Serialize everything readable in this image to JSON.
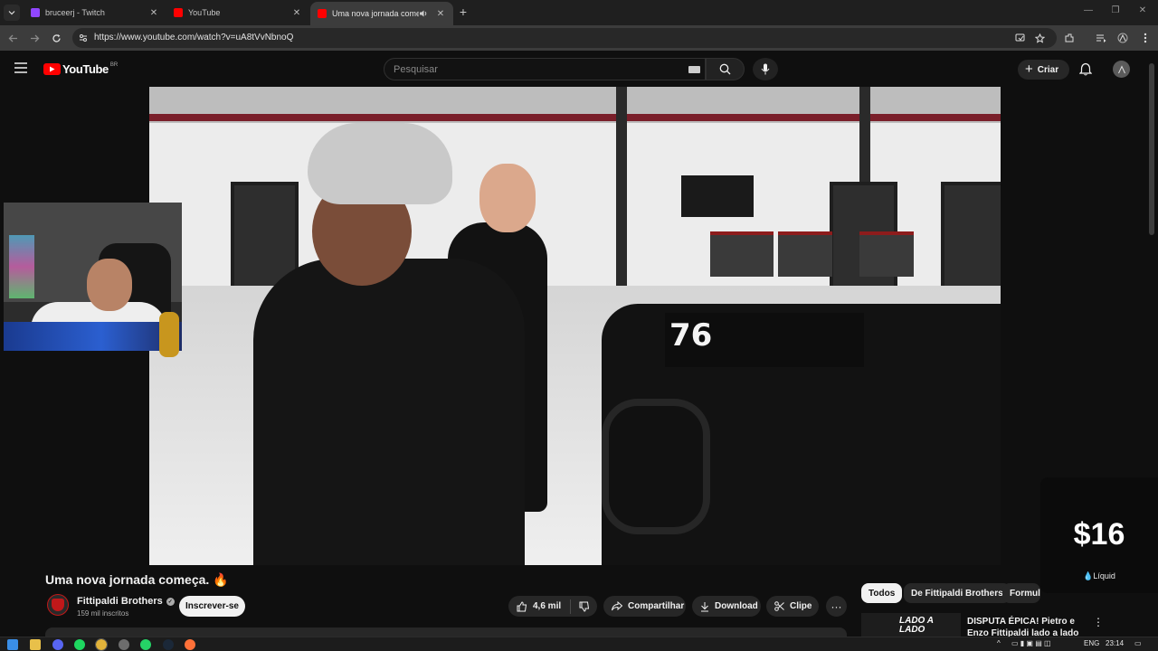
{
  "browser": {
    "tabs": [
      {
        "title": "bruceerj - Twitch",
        "favicon_color": "#9146ff",
        "active": false
      },
      {
        "title": "YouTube",
        "favicon_color": "#ff0000",
        "active": false
      },
      {
        "title": "Uma nova jornada começa",
        "favicon_color": "#ff0000",
        "active": true,
        "audio": true
      }
    ],
    "url": "https://www.youtube.com/watch?v=uA8tVvNbnoQ",
    "new_tab_label": "+",
    "window_controls": {
      "minimize": "—",
      "restore": "❐",
      "close": "✕"
    }
  },
  "youtube": {
    "logo_text": "YouTube",
    "country_code": "BR",
    "search_placeholder": "Pesquisar",
    "create_label": "Criar"
  },
  "video": {
    "title": "Uma nova jornada começa. 🔥",
    "car_number": "76",
    "donation": {
      "amount": "$16",
      "label": "Líquid"
    }
  },
  "channel": {
    "name": "Fittipaldi Brothers",
    "subscribers": "159 mil inscritos",
    "subscribe_label": "Inscrever-se"
  },
  "actions": {
    "likes": "4,6 mil",
    "share": "Compartilhar",
    "download": "Download",
    "clip": "Clipe",
    "more": "···"
  },
  "sidebar": {
    "chips": [
      "Todos",
      "De Fittipaldi Brothers",
      "Formula"
    ],
    "recommendation": {
      "thumb_text": "LADO A LADO",
      "title": "DISPUTA ÉPICA! Pietro e Enzo Fittipaldi lado a lado em Spa! 🔥"
    }
  },
  "taskbar": {
    "language": "ENG",
    "time": "23:14"
  },
  "colors": {
    "background": "#0f0f0f",
    "youtube_red": "#ff0000",
    "accent_white": "#f1f1f1"
  }
}
